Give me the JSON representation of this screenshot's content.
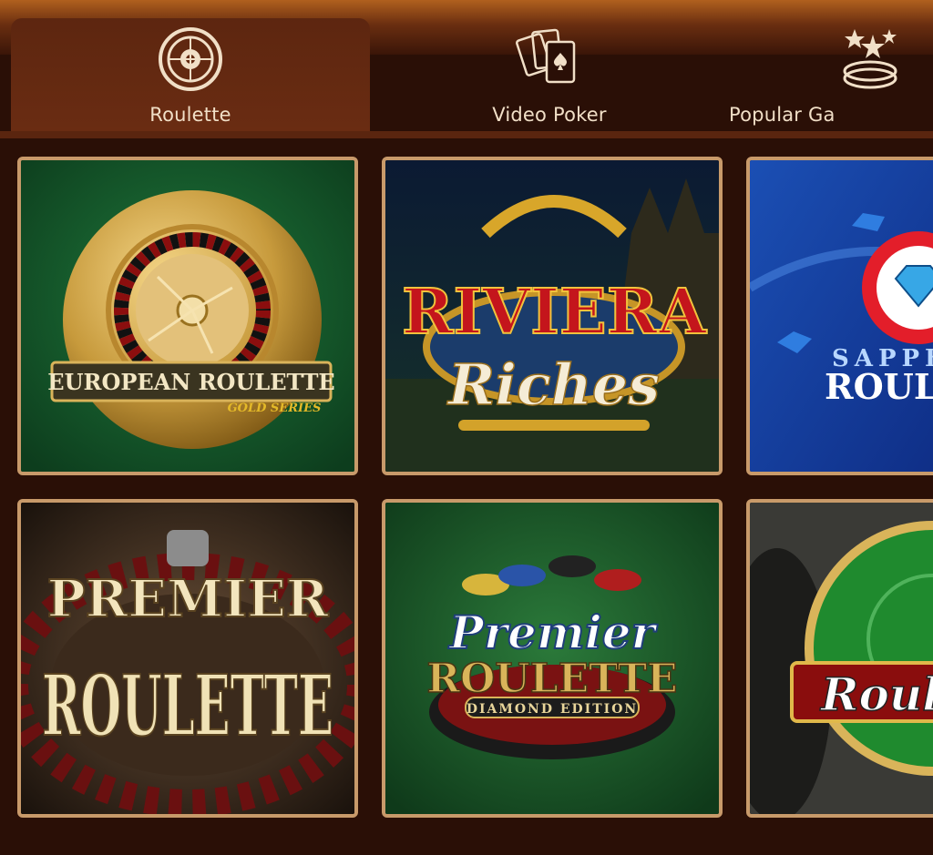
{
  "tabs": [
    {
      "label": "Roulette",
      "icon": "roulette-wheel-icon",
      "active": true
    },
    {
      "label": "Video Poker",
      "icon": "playing-cards-icon",
      "active": false
    },
    {
      "label": "Popular Ga",
      "icon": "stars-chips-icon",
      "active": false
    }
  ],
  "games": [
    {
      "title_line1": "EUROPEAN ROULETTE",
      "title_line2": "GOLD SERIES"
    },
    {
      "title_line1": "RIVIERA",
      "title_line2": "Riches"
    },
    {
      "title_line1": "SAPPH",
      "title_line2": "ROUL"
    },
    {
      "title_line1": "PREMIER",
      "title_line2": "ROULETTE"
    },
    {
      "title_line1": "Premier",
      "title_line2": "ROULETTE",
      "title_line3": "DIAMOND EDITION"
    },
    {
      "title_line1": "Roul"
    }
  ],
  "colors": {
    "background": "#2a0f06",
    "tab_active": "#642a11",
    "tile_border": "#c89a6a",
    "tab_text": "#f1dfc7"
  }
}
